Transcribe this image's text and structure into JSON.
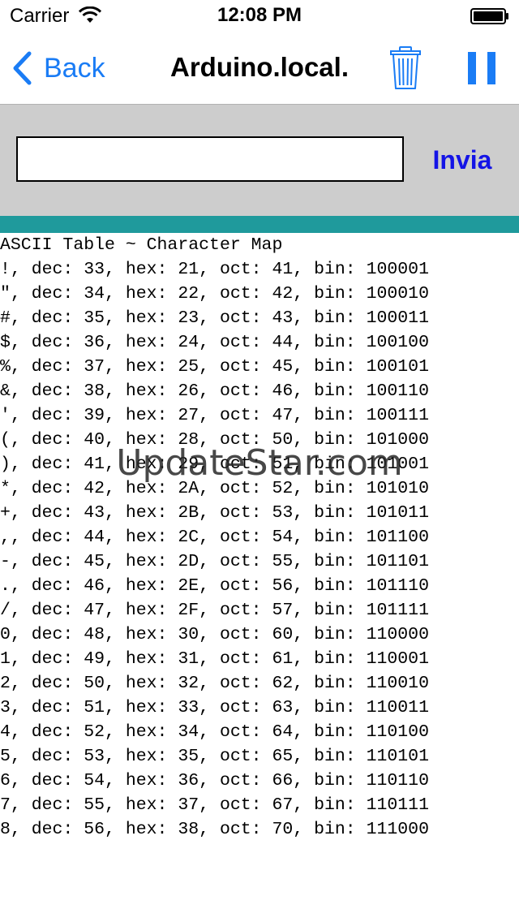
{
  "status_bar": {
    "carrier": "Carrier",
    "time": "12:08 PM",
    "icons": [
      "wifi-icon",
      "battery-icon"
    ]
  },
  "nav_bar": {
    "back_label": "Back",
    "title": "Arduino.local.",
    "icons": [
      "chevron-left-icon",
      "trash-icon",
      "pause-icon"
    ],
    "accent_color": "#1a7cf5"
  },
  "input_panel": {
    "message_value": "",
    "send_label": "Invia",
    "send_color": "#1414e6",
    "background_color": "#cdcdcd",
    "divider_color": "#1f9a9c"
  },
  "serial_output": {
    "lines": [
      "ASCII Table ~ Character Map",
      "!, dec: 33, hex: 21, oct: 41, bin: 100001",
      "\", dec: 34, hex: 22, oct: 42, bin: 100010",
      "#, dec: 35, hex: 23, oct: 43, bin: 100011",
      "$, dec: 36, hex: 24, oct: 44, bin: 100100",
      "%, dec: 37, hex: 25, oct: 45, bin: 100101",
      "&, dec: 38, hex: 26, oct: 46, bin: 100110",
      "', dec: 39, hex: 27, oct: 47, bin: 100111",
      "(, dec: 40, hex: 28, oct: 50, bin: 101000",
      "), dec: 41, hex: 29, oct: 51, bin: 101001",
      "*, dec: 42, hex: 2A, oct: 52, bin: 101010",
      "+, dec: 43, hex: 2B, oct: 53, bin: 101011",
      ",, dec: 44, hex: 2C, oct: 54, bin: 101100",
      "-, dec: 45, hex: 2D, oct: 55, bin: 101101",
      "., dec: 46, hex: 2E, oct: 56, bin: 101110",
      "/, dec: 47, hex: 2F, oct: 57, bin: 101111",
      "0, dec: 48, hex: 30, oct: 60, bin: 110000",
      "1, dec: 49, hex: 31, oct: 61, bin: 110001",
      "2, dec: 50, hex: 32, oct: 62, bin: 110010",
      "3, dec: 51, hex: 33, oct: 63, bin: 110011",
      "4, dec: 52, hex: 34, oct: 64, bin: 110100",
      "5, dec: 53, hex: 35, oct: 65, bin: 110101",
      "6, dec: 54, hex: 36, oct: 66, bin: 110110",
      "7, dec: 55, hex: 37, oct: 67, bin: 110111",
      "8, dec: 56, hex: 38, oct: 70, bin: 111000"
    ]
  },
  "watermark": {
    "text": "UpdateStar.com"
  }
}
